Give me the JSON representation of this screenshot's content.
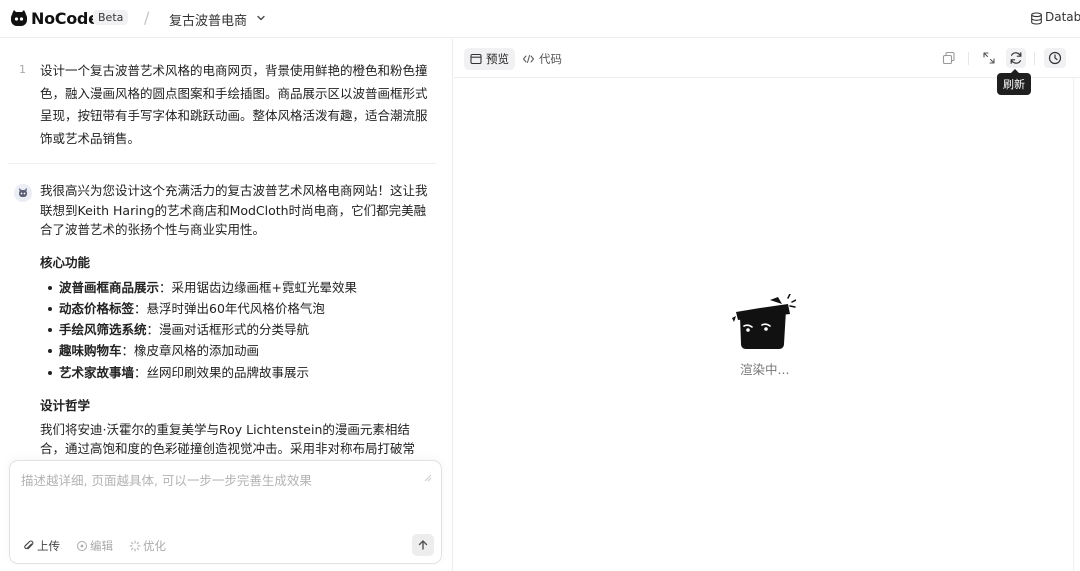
{
  "header": {
    "brand": "NoCode",
    "badge": "Beta",
    "separator": "/",
    "project_name": "复古波普电商",
    "database_label": "Databa"
  },
  "chat": {
    "user_message": {
      "line_number": "1",
      "text": "设计一个复古波普艺术风格的电商网页，背景使用鲜艳的橙色和粉色撞色，融入漫画风格的圆点图案和手绘插图。商品展示区以波普画框形式呈现，按钮带有手写字体和跳跃动画。整体风格活泼有趣，适合潮流服饰或艺术品销售。"
    },
    "assistant_message": {
      "intro": "我很高兴为您设计这个充满活力的复古波普艺术风格电商网站！这让我联想到Keith Haring的艺术商店和ModCloth时尚电商，它们都完美融合了波普艺术的张扬个性与商业实用性。",
      "features_heading": "核心功能",
      "features": [
        {
          "title": "波普画框商品展示",
          "desc": "：采用锯齿边缘画框+霓虹光晕效果"
        },
        {
          "title": "动态价格标签",
          "desc": "：悬浮时弹出60年代风格价格气泡"
        },
        {
          "title": "手绘风筛选系统",
          "desc": "：漫画对话框形式的分类导航"
        },
        {
          "title": "趣味购物车",
          "desc": "：橡皮章风格的添加动画"
        },
        {
          "title": "艺术家故事墙",
          "desc": "：丝网印刷效果的品牌故事展示"
        }
      ],
      "philosophy_heading": "设计哲学",
      "philosophy_text": "我们将安迪·沃霍尔的重复美学与Roy Lichtenstein的漫画元素相结合，通过高饱和度的色彩碰撞创造视觉冲击。采用非对称布局打破常"
    }
  },
  "composer": {
    "placeholder": "描述越详细, 页面越具体, 可以一步一步完善生成效果",
    "value": "",
    "upload_label": "上传",
    "edit_label": "编辑",
    "optimize_label": "优化"
  },
  "preview": {
    "tab_preview": "预览",
    "tab_code": "代码",
    "tooltip_refresh": "刷新",
    "loading_text": "渲染中..."
  },
  "icons": {
    "logo": "nocode-cat-logo-icon",
    "chevron": "chevron-down-icon",
    "database": "database-icon",
    "upload": "paperclip-icon",
    "edit": "edit-target-icon",
    "optimize": "sparkle-icon",
    "send": "arrow-up-icon",
    "preview_tab": "window-icon",
    "code_tab": "code-brackets-icon",
    "copy": "copy-icon",
    "expand": "expand-icon",
    "refresh": "refresh-icon",
    "history": "history-clock-icon",
    "loading_mascot": "box-cat-mascot-icon"
  }
}
